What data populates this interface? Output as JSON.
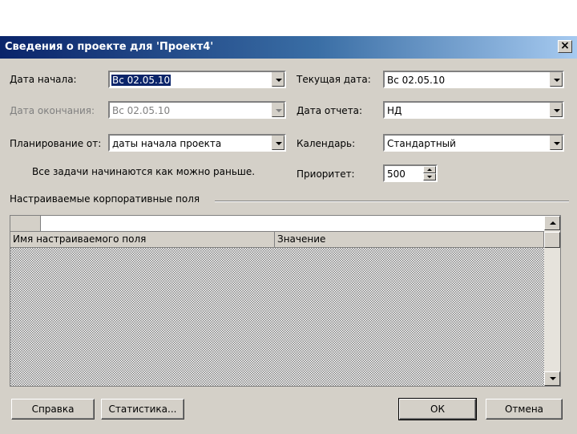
{
  "dialog": {
    "title": "Сведения о проекте для 'Проект4'",
    "close_label": "×"
  },
  "fields": {
    "start_date": {
      "label": "Дата начала:",
      "value": "Вс 02.05.10"
    },
    "finish_date": {
      "label": "Дата окончания:",
      "value": "Вс 02.05.10",
      "disabled": true
    },
    "schedule_from": {
      "label": "Планирование от:",
      "value": "даты начала проекта"
    },
    "current_date": {
      "label": "Текущая дата:",
      "value": "Вс 02.05.10"
    },
    "status_date": {
      "label": "Дата отчета:",
      "value": "НД"
    },
    "calendar": {
      "label": "Календарь:",
      "value": "Стандартный"
    },
    "priority": {
      "label": "Приоритет:",
      "value": "500"
    }
  },
  "schedule_note": "Все задачи начинаются как можно раньше.",
  "custom_fields": {
    "group_label": "Настраиваемые корпоративные поля",
    "columns": [
      "Имя настраиваемого поля",
      "Значение"
    ]
  },
  "buttons": {
    "help": "Справка",
    "statistics": "Статистика...",
    "ok": "ОК",
    "cancel": "Отмена"
  },
  "colors": {
    "titlebar_start": "#0a246a",
    "titlebar_end": "#a6caf0",
    "dialog_bg": "#d4d0c8",
    "selection": "#0a246a"
  }
}
